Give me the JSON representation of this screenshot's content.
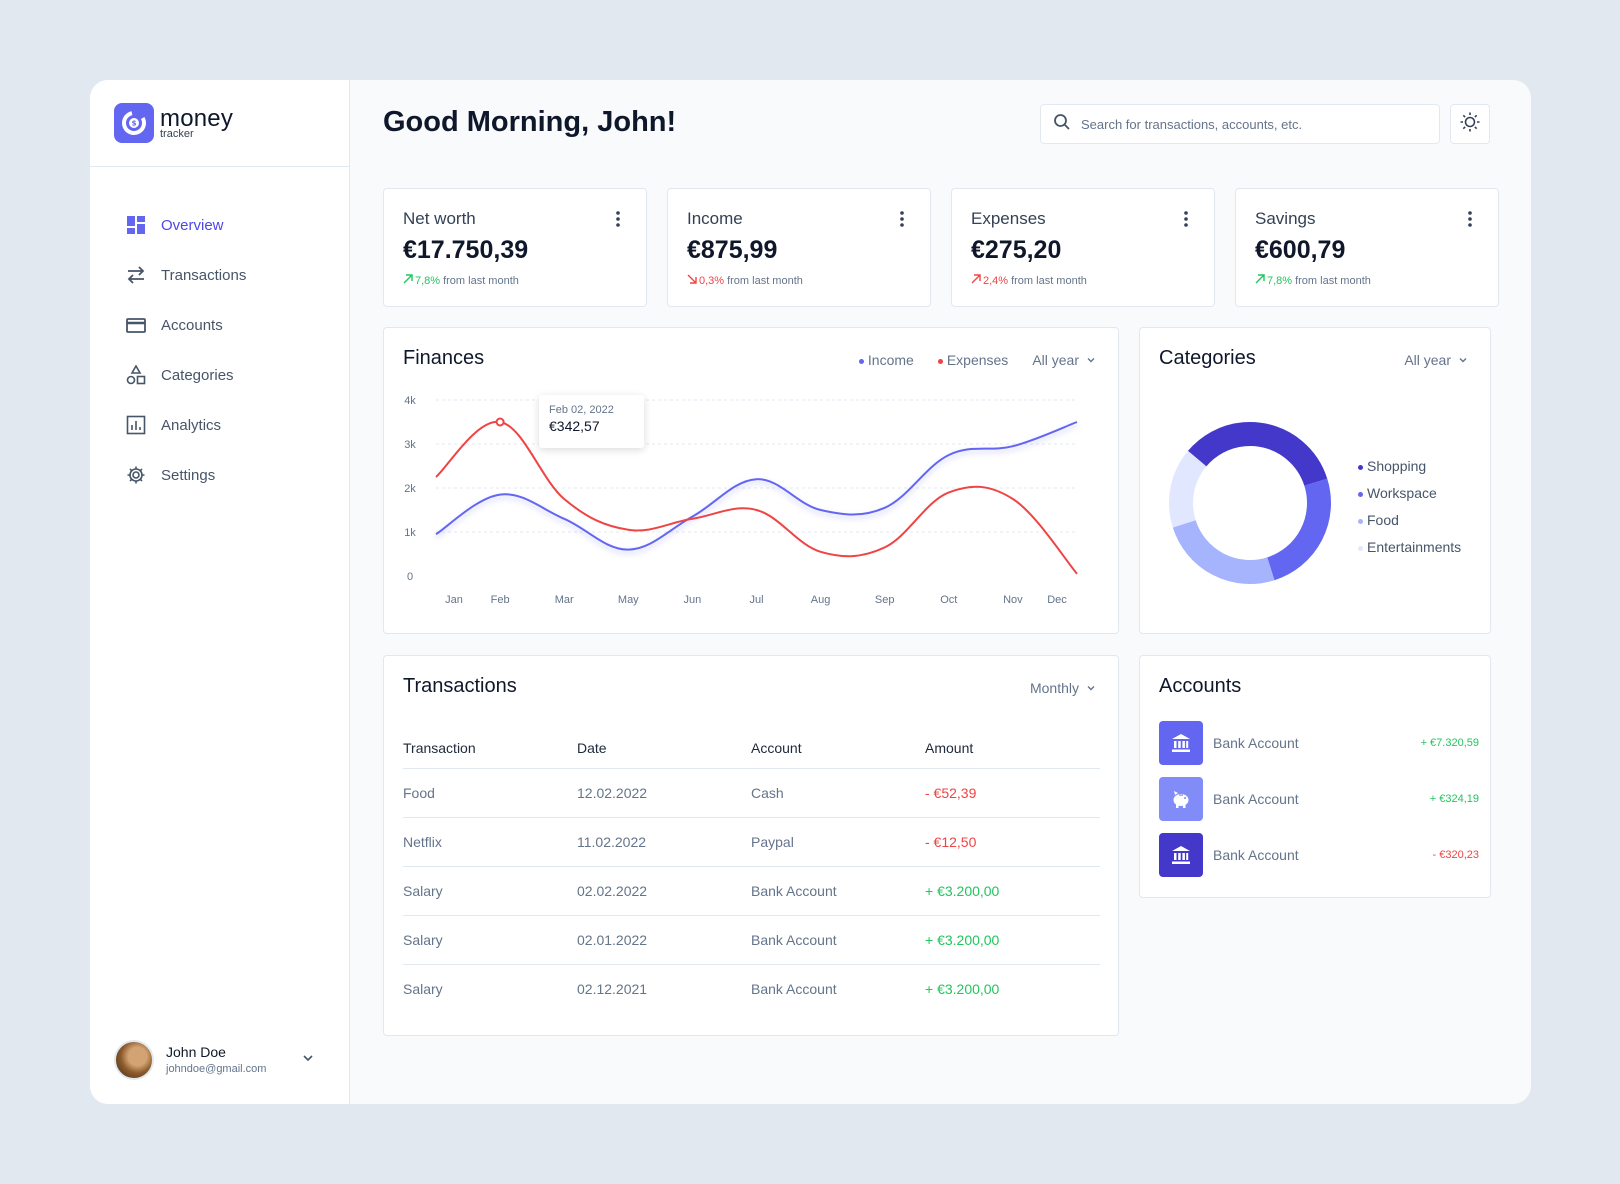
{
  "app": {
    "logo_title": "money",
    "logo_subtitle": "tracker"
  },
  "sidebar": {
    "items": [
      {
        "label": "Overview",
        "icon": "dashboard-icon",
        "active": true
      },
      {
        "label": "Transactions",
        "icon": "transfer-arrows-icon"
      },
      {
        "label": "Accounts",
        "icon": "credit-card-icon"
      },
      {
        "label": "Categories",
        "icon": "shapes-icon"
      },
      {
        "label": "Analytics",
        "icon": "bar-chart-icon"
      },
      {
        "label": "Settings",
        "icon": "gear-icon"
      }
    ],
    "user": {
      "name": "John Doe",
      "email": "johndoe@gmail.com"
    }
  },
  "header": {
    "greeting": "Good Morning, John!",
    "search_placeholder": "Search for transactions, accounts, etc."
  },
  "stats": [
    {
      "label": "Net worth",
      "value": "€17.750,39",
      "change": "7,8%",
      "direction": "up",
      "suffix": "from last month"
    },
    {
      "label": "Income",
      "value": "€875,99",
      "change": "0,3%",
      "direction": "down",
      "suffix": "from last month"
    },
    {
      "label": "Expenses",
      "value": "€275,20",
      "change": "2,4%",
      "direction": "up-bad",
      "suffix": "from last month"
    },
    {
      "label": "Savings",
      "value": "€600,79",
      "change": "7,8%",
      "direction": "up",
      "suffix": "from last month"
    }
  ],
  "finances": {
    "title": "Finances",
    "legend_income": "Income",
    "legend_expenses": "Expenses",
    "filter": "All year",
    "tooltip_date": "Feb 02, 2022",
    "tooltip_value": "€342,57"
  },
  "chart_data": {
    "type": "line",
    "categories": [
      "Jan",
      "Feb",
      "Mar",
      "May",
      "Jun",
      "Jul",
      "Aug",
      "Sep",
      "Oct",
      "Nov",
      "Dec"
    ],
    "y_ticks": [
      "4k",
      "3k",
      "2k",
      "1k",
      "0"
    ],
    "ylim": [
      0,
      4000
    ],
    "series": [
      {
        "name": "Income",
        "color": "#6366f1",
        "values": [
          950,
          1850,
          1300,
          600,
          1350,
          2200,
          1500,
          1550,
          2750,
          2950,
          3500
        ]
      },
      {
        "name": "Expenses",
        "color": "#ef4444",
        "values": [
          2250,
          3500,
          1750,
          1050,
          1300,
          1500,
          550,
          650,
          1900,
          1750,
          50
        ]
      }
    ],
    "highlight": {
      "series": "Expenses",
      "index": 1
    }
  },
  "categories_card": {
    "title": "Categories",
    "filter": "All year",
    "chart_data": {
      "type": "pie",
      "labels": [
        "Shopping",
        "Workspace",
        "Food",
        "Entertainments"
      ],
      "values": [
        34,
        25,
        25,
        16
      ],
      "colors": [
        "#4338ca",
        "#6366f1",
        "#a5b4fc",
        "#e0e7ff"
      ]
    }
  },
  "transactions": {
    "title": "Transactions",
    "filter": "Monthly",
    "columns": [
      "Transaction",
      "Date",
      "Account",
      "Amount"
    ],
    "rows": [
      {
        "name": "Food",
        "date": "12.02.2022",
        "account": "Cash",
        "amount": "- €52,39",
        "type": "neg"
      },
      {
        "name": "Netflix",
        "date": "11.02.2022",
        "account": "Paypal",
        "amount": "- €12,50",
        "type": "neg"
      },
      {
        "name": "Salary",
        "date": "02.02.2022",
        "account": "Bank Account",
        "amount": "+ €3.200,00",
        "type": "pos"
      },
      {
        "name": "Salary",
        "date": "02.01.2022",
        "account": "Bank Account",
        "amount": "+ €3.200,00",
        "type": "pos"
      },
      {
        "name": "Salary",
        "date": "02.12.2021",
        "account": "Bank Account",
        "amount": "+ €3.200,00",
        "type": "pos"
      }
    ]
  },
  "accounts": {
    "title": "Accounts",
    "items": [
      {
        "name": "Bank Account",
        "amount": "+ €7.320,59",
        "type": "pos",
        "icon": "bank-icon",
        "color": "#6366f1"
      },
      {
        "name": "Bank Account",
        "amount": "+ €324,19",
        "type": "pos",
        "icon": "piggy-bank-icon",
        "color": "#818cf8"
      },
      {
        "name": "Bank Account",
        "amount": "- €320,23",
        "type": "neg",
        "icon": "bank-icon",
        "color": "#4338ca"
      }
    ]
  }
}
